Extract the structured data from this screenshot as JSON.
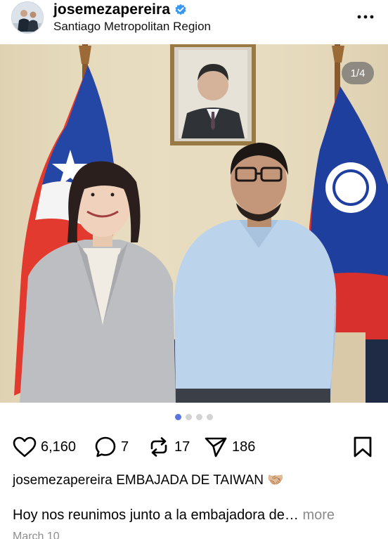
{
  "post": {
    "username": "josemezapereira",
    "location": "Santiago Metropolitan Region",
    "verified_icon": "verified-badge-icon",
    "more_icon": "more-options-icon"
  },
  "media": {
    "counter": "1/4",
    "page_count": 4,
    "active_page": 1
  },
  "actions": {
    "likes": "6,160",
    "comments": "7",
    "reposts": "17",
    "shares": "186",
    "icons": [
      "heart-icon",
      "comment-icon",
      "repost-icon",
      "share-icon",
      "bookmark-icon"
    ]
  },
  "caption": {
    "username": "josemezapereira",
    "title": "EMBAJADA DE TAIWAN",
    "emoji": "🤝🏼",
    "body": "Hoy nos reunimos junto a la embajadora de…",
    "more_label": "more",
    "date": "March 10"
  },
  "colors": {
    "accent_dot": "#5a74e0",
    "verified_blue": "#3897f0",
    "muted_text": "#8a8a8a"
  }
}
